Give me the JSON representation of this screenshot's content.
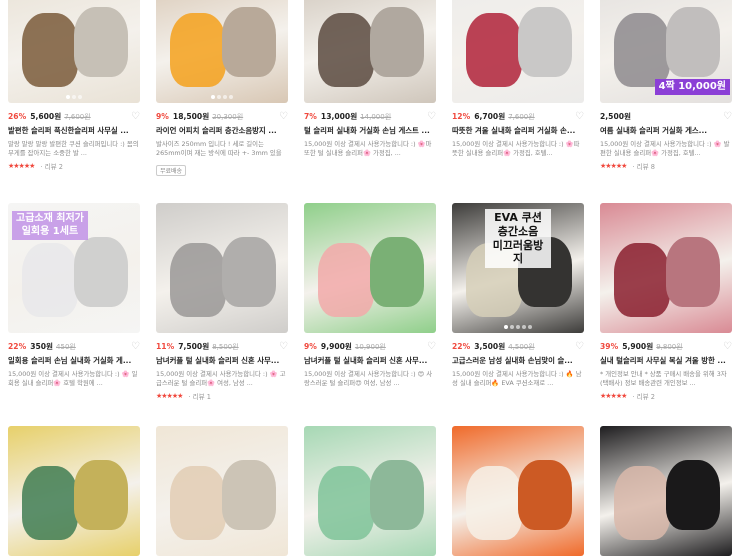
{
  "products": [
    {
      "discount": "26%",
      "price": "5,600원",
      "original": "7,600원",
      "title": "발편한 슬리퍼 푹신한슬리퍼 사무실 ...",
      "desc": "말랑 말랑 말랑 발편한 쿠션 슬리퍼입니다 :) 몸의 무게를 잡아지는 소중한 발 ...",
      "stars": "★★★★★",
      "review": "· 리뷰 2",
      "badge": "",
      "overlay": "",
      "colors": [
        "#e9e2d6",
        "#7a5a3a"
      ],
      "dots": 3
    },
    {
      "discount": "9%",
      "price": "18,500원",
      "original": "20,300원",
      "title": "라이언 어피치 슬리퍼 층간소음방지 ...",
      "desc": "발사이즈 250mm 입니다 ! 세로 길이는 265mm이며 재는 방식에 따라 +- 3mm 있을 ...",
      "stars": "",
      "review": "",
      "badge": "무료배송",
      "overlay": "",
      "colors": [
        "#d8c7b4",
        "#f4a11c"
      ],
      "dots": 4
    },
    {
      "discount": "7%",
      "price": "13,000원",
      "original": "14,000원",
      "title": "털 슬리퍼 실내화 거실화 손님 게스트 ...",
      "desc": "15,000원 이상 결제시 사용가능합니다 :) 🌸마또한 털 실내용 슬리퍼🌸 가정집, ...",
      "stars": "",
      "review": "",
      "badge": "",
      "overlay": "",
      "colors": [
        "#cfc6bb",
        "#5a4a40"
      ],
      "dots": 0
    },
    {
      "discount": "12%",
      "price": "6,700원",
      "original": "7,600원",
      "title": "따뜻한 겨울 실내화 슬리퍼 거실화 손...",
      "desc": "15,000원 이상 결제시 사용가능합니다 :) 🌸따뜻한 실내용 슬리퍼🌸 가정집, 호텔...",
      "stars": "",
      "review": "",
      "badge": "",
      "overlay": "",
      "colors": [
        "#ecebea",
        "#b0223a"
      ],
      "dots": 0
    },
    {
      "discount": "",
      "price": "2,500원",
      "original": "",
      "title": "여름 실내화 슬리퍼 거실화 게스...",
      "desc": "15,000원 이상 결제시 사용가능합니다 :) 🌸 발편한 실내용 슬리퍼🌸 가정집, 호텔...",
      "stars": "★★★★★",
      "review": "· 리뷰 8",
      "badge": "",
      "overlay": "4짝 10,000원",
      "colors": [
        "#e3e0de",
        "#8d8a8d"
      ],
      "dots": 0
    },
    {
      "discount": "22%",
      "price": "350원",
      "original": "450원",
      "title": "일회용 슬리퍼 손님 실내화 거실화 게...",
      "desc": "15,000원 이상 결제시 사용가능합니다 :) 🌸 일회용 실내 슬리퍼🌸 호텔 학원에 ...",
      "stars": "",
      "review": "",
      "badge": "",
      "overlay": "고급소재 최저가\n일회용 1세트",
      "colors": [
        "#f5f5f4",
        "#e8e8ea"
      ],
      "dots": 0
    },
    {
      "discount": "11%",
      "price": "7,500원",
      "original": "8,500원",
      "title": "남녀커플 털 실내화 슬리퍼 신혼 사무...",
      "desc": "15,000원 이상 결제시 사용가능합니다 :) 🌸 고급스러운 털 슬리퍼🌸 여성, 남성 ...",
      "stars": "★★★★★",
      "review": "· 리뷰 1",
      "badge": "",
      "overlay": "",
      "colors": [
        "#cfcdca",
        "#9a9896"
      ],
      "dots": 0
    },
    {
      "discount": "9%",
      "price": "9,900원",
      "original": "10,900원",
      "title": "남녀커플 털 실내화 슬리퍼 신혼 사무...",
      "desc": "15,000원 이상 결제시 사용가능합니다 :) 😍 사랑스러운 털 슬리퍼😍 여성, 남성 ...",
      "stars": "",
      "review": "",
      "badge": "",
      "overlay": "",
      "colors": [
        "#8fcf8a",
        "#f2a9a9"
      ],
      "dots": 0
    },
    {
      "discount": "22%",
      "price": "3,500원",
      "original": "4,500원",
      "title": "고급스러운 남성 실내화 손님맞이 슬...",
      "desc": "15,000원 이상 결제시 사용가능합니다 :) 🔥 남성 실내 슬리퍼🔥 EVA 쿠션소재로 ...",
      "stars": "",
      "review": "",
      "badge": "",
      "overlay": "EVA 쿠션\n층간소음\n미끄러움방지",
      "colors": [
        "#3d3c3a",
        "#d6cfb8"
      ],
      "dots": 5
    },
    {
      "discount": "39%",
      "price": "5,900원",
      "original": "9,800원",
      "title": "실내 털슬리퍼 사무실 복실 겨울 방한 ...",
      "desc": "* 개인정보 안내 * 상품 구매시 배송을 위해 3자(택배사) 정보 배송관련 개인정보 ...",
      "stars": "★★★★★",
      "review": "· 리뷰 2",
      "badge": "",
      "overlay": "",
      "colors": [
        "#d98a94",
        "#8a1e2e"
      ],
      "dots": 0
    },
    {
      "discount": "",
      "price": "",
      "original": "",
      "title": "",
      "desc": "",
      "stars": "",
      "review": "",
      "badge": "",
      "overlay": "",
      "colors": [
        "#e7d06a",
        "#3f7d52"
      ],
      "dots": 0
    },
    {
      "discount": "",
      "price": "",
      "original": "",
      "title": "",
      "desc": "",
      "stars": "",
      "review": "",
      "badge": "",
      "overlay": "",
      "colors": [
        "#f0e6d6",
        "#e2cdb4"
      ],
      "dots": 0
    },
    {
      "discount": "",
      "price": "",
      "original": "",
      "title": "",
      "desc": "",
      "stars": "",
      "review": "",
      "badge": "",
      "overlay": "",
      "colors": [
        "#a6d8b4",
        "#7fc399"
      ],
      "dots": 0
    },
    {
      "discount": "",
      "price": "",
      "original": "",
      "title": "",
      "desc": "",
      "stars": "",
      "review": "",
      "badge": "",
      "overlay": "",
      "colors": [
        "#f06a2a",
        "#f6f0e6"
      ],
      "dots": 0
    },
    {
      "discount": "",
      "price": "",
      "original": "",
      "title": "",
      "desc": "",
      "stars": "",
      "review": "",
      "badge": "",
      "overlay": "",
      "colors": [
        "#1e1d1f",
        "#d9b9aa"
      ],
      "dots": 0
    }
  ],
  "heart_icon": "heart-outline-icon"
}
